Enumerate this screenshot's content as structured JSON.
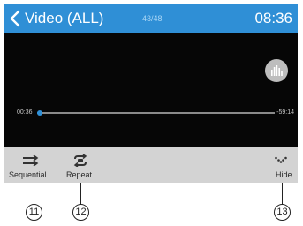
{
  "header": {
    "title": "Video (ALL)",
    "counter": "43/48",
    "clock": "08:36",
    "icons": {
      "back": "chevron-left-icon"
    }
  },
  "player": {
    "icons": {
      "equalizer": "equalizer-icon"
    },
    "elapsed": "00:36",
    "remaining": "-59:14",
    "progress": 0.01
  },
  "controls": {
    "sequential": {
      "label": "Sequential",
      "icon": "sequential-icon"
    },
    "repeat": {
      "label": "Repeat",
      "icon": "repeat-icon"
    },
    "hide": {
      "label": "Hide",
      "icon": "chevron-down-icon"
    }
  },
  "callouts": [
    "11",
    "12",
    "13"
  ],
  "colors": {
    "header_bg": "#2f8fd6",
    "video_bg": "#060606",
    "controls_bg": "#d3d3d3",
    "accent": "#2f8fd6"
  }
}
